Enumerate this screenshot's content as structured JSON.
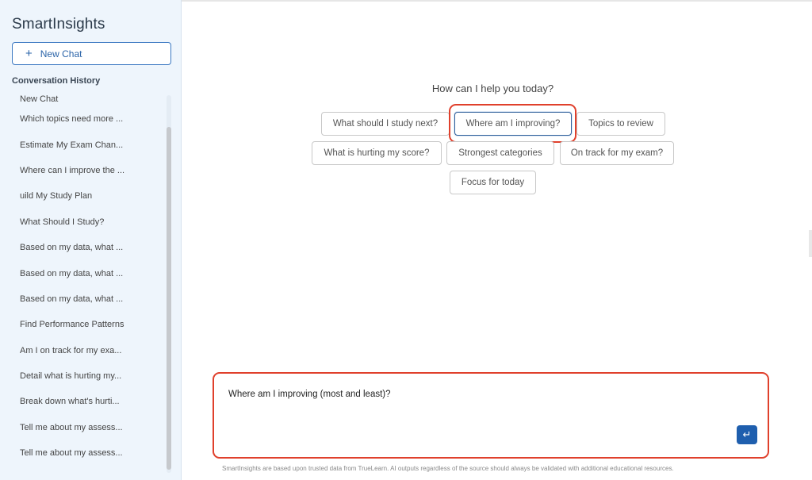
{
  "app": {
    "title": "SmartInsights"
  },
  "sidebar": {
    "new_chat_label": "New Chat",
    "history_heading": "Conversation History",
    "items": [
      "New Chat",
      "Which topics need more ...",
      "Estimate My Exam Chan...",
      "Where can I improve the ...",
      "uild My Study Plan",
      "What Should I Study?",
      "Based on my data, what ...",
      "Based on my data, what ...",
      "Based on my data, what ...",
      "Find Performance Patterns",
      "Am I on track for my exa...",
      "Detail what is hurting my...",
      "Break down what's hurti...",
      "Tell me about my assess...",
      "Tell me about my assess..."
    ]
  },
  "main": {
    "greeting": "How can I help you today?",
    "suggestions": [
      "What should I study next?",
      "Where am I improving?",
      "Topics to review",
      "What is hurting my score?",
      "Strongest categories",
      "On track for my exam?",
      "Focus for today"
    ],
    "selected_suggestion": "Where am I improving?",
    "input_value": "Where am I improving (most and least)?",
    "send_icon": "enter-return-icon",
    "disclaimer": "SmartInsights are based upon trusted data from TrueLearn. AI outputs regardless of the source should always be validated with additional educational resources."
  },
  "colors": {
    "accent": "#1f5fae",
    "highlight": "#e0402c",
    "sidebar_bg": "#eef5fc"
  }
}
